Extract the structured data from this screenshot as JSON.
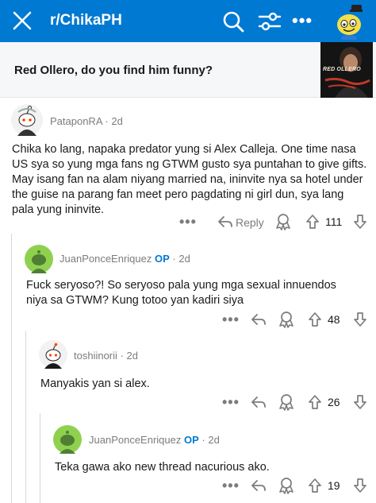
{
  "header": {
    "subreddit": "r/ChikaPH",
    "more_label": "•••"
  },
  "post": {
    "title": "Red Ollero, do you find him funny?",
    "thumbnail_text": "RED OLLERO"
  },
  "comments": [
    {
      "username": "PataponRA",
      "op": "",
      "age": "· 2d",
      "body": "Chika ko lang, napaka predator yung si Alex Calleja. One time nasa US sya so yung mga fans ng GTWM gusto sya puntahan to give gifts. May isang fan na alam niyang married na, ininvite nya sa hotel under the guise na parang fan meet pero pagdating ni girl dun, sya lang pala yung ininvite.",
      "more": "•••",
      "reply": "Reply",
      "votes": "111"
    },
    {
      "username": "JuanPonceEnriquez",
      "op": "OP",
      "age": "· 2d",
      "body": "Fuck seryoso?! So seryoso pala yung mga sexual innuendos niya sa GTWM? Kung totoo yan kadiri siya",
      "more": "•••",
      "votes": "48"
    },
    {
      "username": "toshiinorii",
      "op": "",
      "age": "· 2d",
      "body": "Manyakis yan si alex.",
      "more": "•••",
      "votes": "26"
    },
    {
      "username": "JuanPonceEnriquez",
      "op": "OP",
      "age": "· 2d",
      "body": "Teka gawa ako new thread nacurious ako.",
      "more": "•••",
      "votes": "19"
    }
  ],
  "colors": {
    "header_bg": "#0079d3",
    "op_blue": "#0079d3",
    "avatar_green": "#8fd14f",
    "meta_gray": "#7c7c7c"
  }
}
